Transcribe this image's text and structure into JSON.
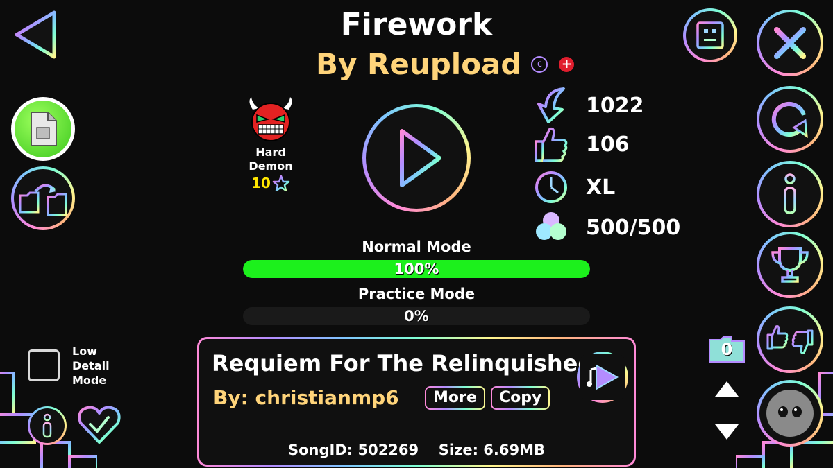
{
  "level": {
    "name": "Firework",
    "author": "By Reupload",
    "difficulty": "Hard Demon",
    "difficulty_line1": "Hard",
    "difficulty_line2": "Demon",
    "stars": "10",
    "copy_badge": "c",
    "plus_badge": "+"
  },
  "stats": {
    "downloads": "1022",
    "likes": "106",
    "length": "XL",
    "orbs": "500/500"
  },
  "progress": {
    "normal_label": "Normal Mode",
    "normal_value": "100%",
    "normal_fraction": 1.0,
    "practice_label": "Practice Mode",
    "practice_value": "0%",
    "practice_fraction": 0.0
  },
  "song": {
    "title": "Requiem For The Relinquished",
    "artist": "By: christianmp6",
    "more_label": "More",
    "copy_label": "Copy",
    "song_id_label": "SongID: 502269",
    "size_label": "Size: 6.69MB"
  },
  "options": {
    "low_detail_label_1": "Low",
    "low_detail_label_2": "Detail",
    "low_detail_label_3": "Mode",
    "low_detail_checked": false
  },
  "folder_count": "0",
  "colors": {
    "progress_fill": "#1cf01c",
    "author_gold": "#ffd47a",
    "stars_yellow": "#ffe600"
  },
  "icons": {
    "back": "back-arrow-icon",
    "doc": "level-info-doc-icon",
    "folders": "move-folders-icon",
    "play": "play-icon",
    "close": "close-x-icon",
    "refresh": "refresh-icon",
    "info": "info-icon",
    "trophy": "leaderboard-trophy-icon",
    "rate": "like-dislike-icon",
    "face": "comments-face-icon"
  }
}
